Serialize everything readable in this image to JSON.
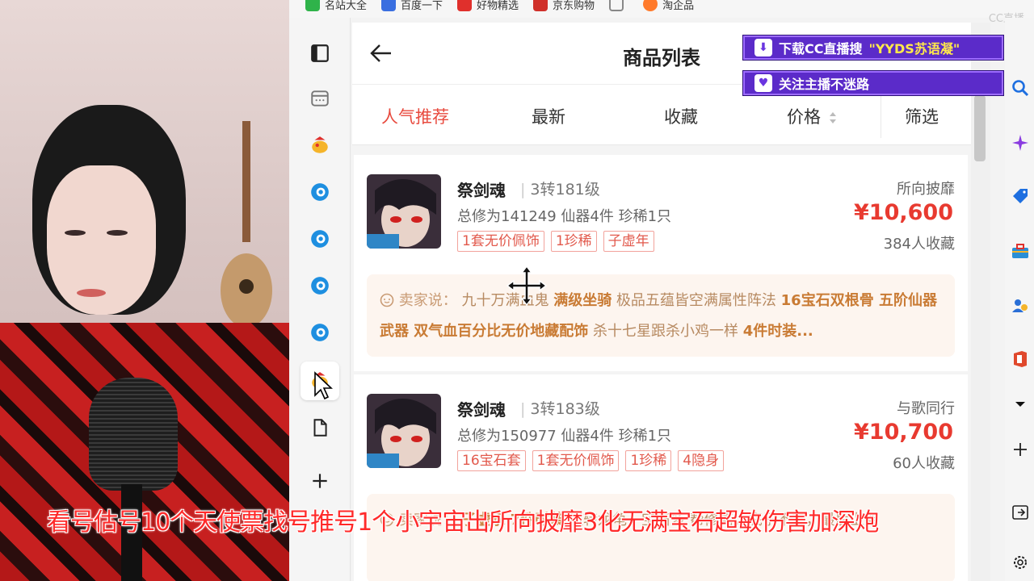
{
  "bookmarks": [
    {
      "label": "名站大全",
      "color": "#2fb34a"
    },
    {
      "label": "百度一下",
      "color": "#3a6fe0"
    },
    {
      "label": "好物精选",
      "color": "#e0302c"
    },
    {
      "label": "京东购物",
      "color": "#d0302a"
    },
    {
      "label": "",
      "color": "#888888"
    },
    {
      "label": "淘企品",
      "color": "#ff7a2b"
    }
  ],
  "watermark": "CC直播",
  "app": {
    "title": "商品列表",
    "tabs": [
      {
        "label": "人气推荐",
        "active": true
      },
      {
        "label": "最新",
        "active": false
      },
      {
        "label": "收藏",
        "active": false
      },
      {
        "label": "价格",
        "active": false
      },
      {
        "label": "筛选",
        "active": false
      }
    ],
    "items": [
      {
        "name": "祭剑魂",
        "level": "3转181级",
        "stats": "总修为141249  仙器4件  珍稀1只",
        "tags": [
          "1套无价佩饰",
          "1珍稀",
          "子虚年"
        ],
        "server": "所向披靡",
        "price": "¥10,600",
        "favorites": "384人收藏",
        "seller_label": "卖家说：",
        "seller_segments": [
          {
            "text": "九十万满血鬼 ",
            "bold": false
          },
          {
            "text": "满级坐骑",
            "bold": true
          },
          {
            "text": " 极品五蕴皆空满属性阵法 ",
            "bold": false
          },
          {
            "text": "16宝石双根骨 五阶仙器武器 双气血百分比无价地藏配饰",
            "bold": true
          },
          {
            "text": " 杀十七星跟杀小鸡一样 ",
            "bold": false
          },
          {
            "text": "4件时装...",
            "bold": true
          }
        ]
      },
      {
        "name": "祭剑魂",
        "level": "3转183级",
        "stats": "总修为150977  仙器4件  珍稀1只",
        "tags": [
          "16宝石套",
          "1套无价佩饰",
          "1珍稀",
          "4隐身"
        ],
        "server": "与歌同行",
        "price": "¥10,700",
        "favorites": "60人收藏",
        "seller_label": "卖家说：",
        "seller_segments": [
          {
            "text": "子虚永 7件时装",
            "bold": true
          },
          {
            "text": " 扭转龙龟，宝石多 帮修高，底子不错，最后上架",
            "bold": false
          }
        ]
      }
    ]
  },
  "overlays": {
    "banner1": {
      "prefix": "下载CC直播搜",
      "highlight": "\"YYDS苏语凝\""
    },
    "banner2": {
      "text": "关注主播不迷路"
    },
    "subtitle": "看号估号10个天使票找号推号1个小宇宙出所向披靡3化无满宝石超敏伤害加深炮"
  },
  "colors": {
    "accent": "#e84a3e",
    "price": "#e83a30",
    "banner": "#5b2bc9"
  }
}
